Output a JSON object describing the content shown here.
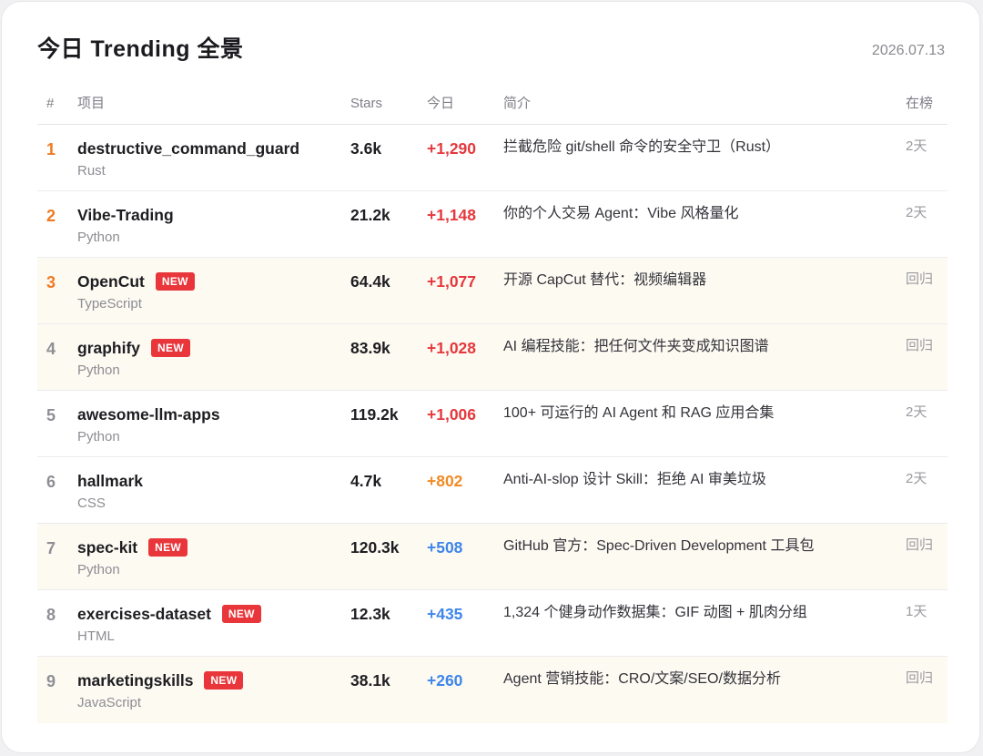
{
  "header": {
    "title": "今日 Trending 全景",
    "date": "2026.07.13"
  },
  "columns": {
    "rank": "#",
    "project": "项目",
    "stars": "Stars",
    "today": "今日",
    "description": "简介",
    "on_list": "在榜"
  },
  "colors": {
    "rank_top": "#f07a22",
    "rank_other": "#8e8e95",
    "gain_high": "#e5383d",
    "gain_mid": "#f08a24",
    "gain_low": "#3f86ea",
    "badge": "#e8363b",
    "highlight_row": "#fdfaf2"
  },
  "rows": [
    {
      "rank": "1",
      "name": "destructive_command_guard",
      "lang": "Rust",
      "stars": "3.6k",
      "today": "+1,290",
      "desc": "拦截危险 git/shell 命令的安全守卫（Rust）",
      "on_list": "2天",
      "new": false,
      "highlight": false,
      "rank_color": "#f07a22",
      "today_color": "#e5383d"
    },
    {
      "rank": "2",
      "name": "Vibe-Trading",
      "lang": "Python",
      "stars": "21.2k",
      "today": "+1,148",
      "desc": "你的个人交易 Agent：Vibe 风格量化",
      "on_list": "2天",
      "new": false,
      "highlight": false,
      "rank_color": "#f07a22",
      "today_color": "#e5383d"
    },
    {
      "rank": "3",
      "name": "OpenCut",
      "lang": "TypeScript",
      "stars": "64.4k",
      "today": "+1,077",
      "desc": "开源 CapCut 替代：视频编辑器",
      "on_list": "回归",
      "new": true,
      "badge": "NEW",
      "highlight": true,
      "rank_color": "#f07a22",
      "today_color": "#e5383d"
    },
    {
      "rank": "4",
      "name": "graphify",
      "lang": "Python",
      "stars": "83.9k",
      "today": "+1,028",
      "desc": "AI 编程技能：把任何文件夹变成知识图谱",
      "on_list": "回归",
      "new": true,
      "badge": "NEW",
      "highlight": true,
      "rank_color": "#8e8e95",
      "today_color": "#e5383d"
    },
    {
      "rank": "5",
      "name": "awesome-llm-apps",
      "lang": "Python",
      "stars": "119.2k",
      "today": "+1,006",
      "desc": "100+ 可运行的 AI Agent 和 RAG 应用合集",
      "on_list": "2天",
      "new": false,
      "highlight": false,
      "rank_color": "#8e8e95",
      "today_color": "#e5383d"
    },
    {
      "rank": "6",
      "name": "hallmark",
      "lang": "CSS",
      "stars": "4.7k",
      "today": "+802",
      "desc": "Anti-AI-slop 设计 Skill：拒绝 AI 审美垃圾",
      "on_list": "2天",
      "new": false,
      "highlight": false,
      "rank_color": "#8e8e95",
      "today_color": "#f08a24"
    },
    {
      "rank": "7",
      "name": "spec-kit",
      "lang": "Python",
      "stars": "120.3k",
      "today": "+508",
      "desc": "GitHub 官方：Spec-Driven Development 工具包",
      "on_list": "回归",
      "new": true,
      "badge": "NEW",
      "highlight": true,
      "rank_color": "#8e8e95",
      "today_color": "#3f86ea"
    },
    {
      "rank": "8",
      "name": "exercises-dataset",
      "lang": "HTML",
      "stars": "12.3k",
      "today": "+435",
      "desc": "1,324 个健身动作数据集：GIF 动图 + 肌肉分组",
      "on_list": "1天",
      "new": true,
      "badge": "NEW",
      "highlight": false,
      "rank_color": "#8e8e95",
      "today_color": "#3f86ea"
    },
    {
      "rank": "9",
      "name": "marketingskills",
      "lang": "JavaScript",
      "stars": "38.1k",
      "today": "+260",
      "desc": "Agent 营销技能：CRO/文案/SEO/数据分析",
      "on_list": "回归",
      "new": true,
      "badge": "NEW",
      "highlight": true,
      "rank_color": "#8e8e95",
      "today_color": "#3f86ea"
    }
  ]
}
